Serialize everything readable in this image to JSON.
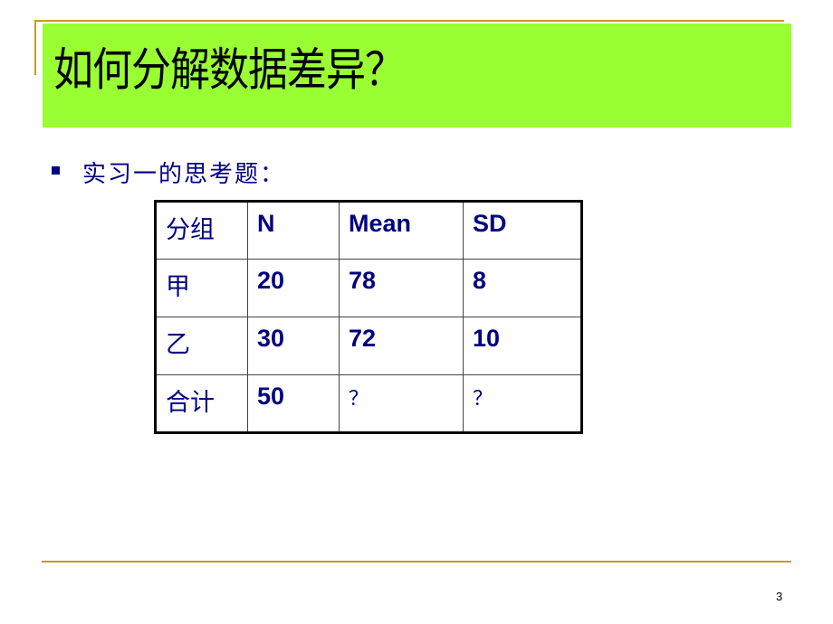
{
  "slide": {
    "title": "如何分解数据差异？",
    "bullet": "实习一的思考题：",
    "page_number": "3",
    "colors": {
      "title_bg": "#99ff33",
      "accent_line": "#c49a2a",
      "text": "#000080"
    }
  },
  "table": {
    "headers": [
      "分组",
      "N",
      "Mean",
      "SD"
    ],
    "rows": [
      [
        "甲",
        "20",
        "78",
        "8"
      ],
      [
        "乙",
        "30",
        "72",
        "10"
      ],
      [
        "合计",
        "50",
        "？",
        "？"
      ]
    ]
  }
}
